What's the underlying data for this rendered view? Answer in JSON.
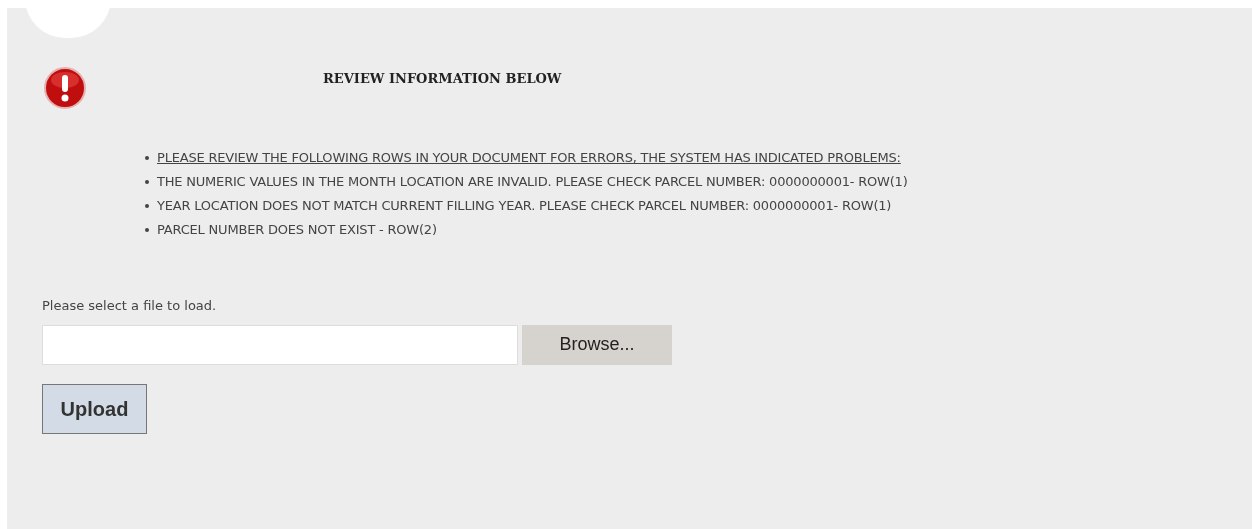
{
  "alert": {
    "title": "REVIEW INFORMATION BELOW",
    "messages": [
      {
        "kind": "heading",
        "text": "PLEASE REVIEW THE FOLLOWING ROWS IN YOUR DOCUMENT FOR ERRORS, THE SYSTEM HAS INDICATED PROBLEMS:"
      },
      {
        "kind": "error",
        "text": "THE NUMERIC VALUES IN THE MONTH LOCATION ARE INVALID. PLEASE CHECK PARCEL NUMBER: 0000000001- ROW(1)"
      },
      {
        "kind": "error",
        "text": "YEAR LOCATION DOES NOT MATCH CURRENT FILLING YEAR. PLEASE CHECK PARCEL NUMBER: 0000000001- ROW(1)"
      },
      {
        "kind": "error",
        "text": "PARCEL NUMBER DOES NOT EXIST - ROW(2)"
      }
    ]
  },
  "upload": {
    "label": "Please select a file to load.",
    "browse_button": "Browse...",
    "upload_button": "Upload"
  }
}
